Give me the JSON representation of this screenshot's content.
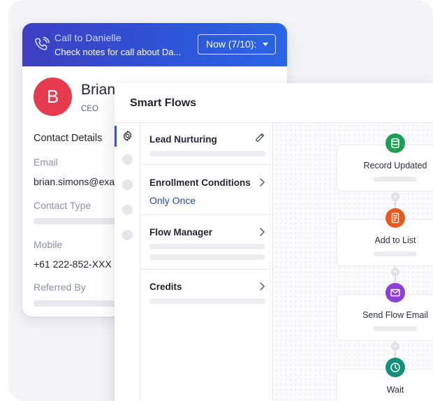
{
  "contact_card": {
    "call_banner": {
      "title": "Call to Danielle",
      "subtitle": "Check notes for call about Da...",
      "time_select": "Now (7/10):"
    },
    "avatar_initial": "B",
    "name": "Brian",
    "role": "CEO",
    "section_title": "Contact Details",
    "fields": {
      "email_label": "Email",
      "email_value": "brian.simons@exa",
      "contact_type_label": "Contact Type",
      "mobile_label": "Mobile",
      "mobile_value": "+61 222-852-XXX",
      "referred_by_label": "Referred By"
    },
    "colors": {
      "banner_start": "#3d3fc0",
      "banner_end": "#2a66e6",
      "avatar": "#e63a4f"
    }
  },
  "smart_flows": {
    "title": "Smart Flows",
    "rail_icons": [
      "gear-icon"
    ],
    "menu": [
      {
        "label": "Lead Nurturing",
        "icon": "pencil-icon"
      },
      {
        "label": "Enrollment Conditions",
        "value": "Only Once",
        "icon": "chevron-right-icon"
      },
      {
        "label": "Flow Manager",
        "icon": "chevron-right-icon"
      },
      {
        "label": "Credits",
        "icon": "chevron-right-icon"
      }
    ],
    "nodes": [
      {
        "label": "Record Updated",
        "icon": "database-icon",
        "color": "#1f9d55"
      },
      {
        "label": "Add to List",
        "icon": "list-document-icon",
        "color": "#e8591f"
      },
      {
        "label": "Send Flow Email",
        "icon": "envelope-icon",
        "color": "#8f3fd8"
      },
      {
        "label": "Wait",
        "icon": "clock-icon",
        "color": "#14907a"
      }
    ],
    "accent": "#3556d4"
  }
}
